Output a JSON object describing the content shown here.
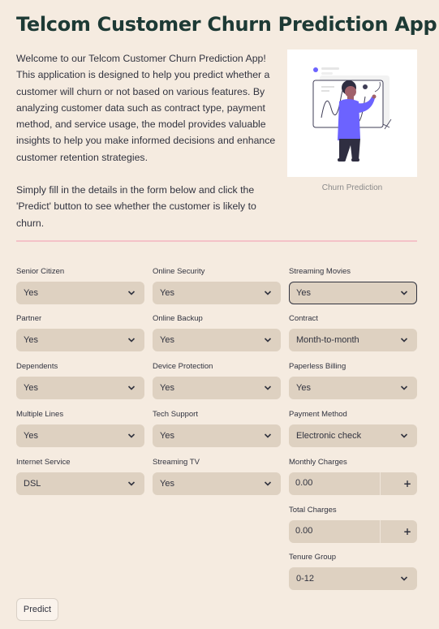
{
  "title": "Telcom Customer Churn Prediction App",
  "intro": {
    "paragraph1": "Welcome to our Telcom Customer Churn Prediction App! This application is designed to help you predict whether a customer will churn or not based on various features. By analyzing customer data such as contract type, payment method, and service usage, the model provides valuable insights to help you make informed decisions and enhance customer retention strategies.",
    "paragraph2": "Simply fill in the details in the form below and click the 'Predict' button to see whether the customer is likely to churn."
  },
  "image": {
    "caption": "Churn Prediction",
    "icon": "person-analyzing-chart-illustration"
  },
  "form": {
    "senior_citizen": {
      "label": "Senior Citizen",
      "value": "Yes"
    },
    "partner": {
      "label": "Partner",
      "value": "Yes"
    },
    "dependents": {
      "label": "Dependents",
      "value": "Yes"
    },
    "multiple_lines": {
      "label": "Multiple Lines",
      "value": "Yes"
    },
    "internet_service": {
      "label": "Internet Service",
      "value": "DSL"
    },
    "online_security": {
      "label": "Online Security",
      "value": "Yes"
    },
    "online_backup": {
      "label": "Online Backup",
      "value": "Yes"
    },
    "device_protection": {
      "label": "Device Protection",
      "value": "Yes"
    },
    "tech_support": {
      "label": "Tech Support",
      "value": "Yes"
    },
    "streaming_tv": {
      "label": "Streaming TV",
      "value": "Yes"
    },
    "streaming_movies": {
      "label": "Streaming Movies",
      "value": "Yes"
    },
    "contract": {
      "label": "Contract",
      "value": "Month-to-month"
    },
    "paperless_billing": {
      "label": "Paperless Billing",
      "value": "Yes"
    },
    "payment_method": {
      "label": "Payment Method",
      "value": "Electronic check"
    },
    "monthly_charges": {
      "label": "Monthly Charges",
      "value": "0.00"
    },
    "total_charges": {
      "label": "Total Charges",
      "value": "0.00"
    },
    "tenure_group": {
      "label": "Tenure Group",
      "value": "0-12"
    }
  },
  "predict_button": "Predict",
  "colors": {
    "background": "#f5ebe0",
    "input_background": "#ded1c1",
    "title": "#1d3a35",
    "divider": "#f4c2c8",
    "accent": "#6c63ff"
  }
}
